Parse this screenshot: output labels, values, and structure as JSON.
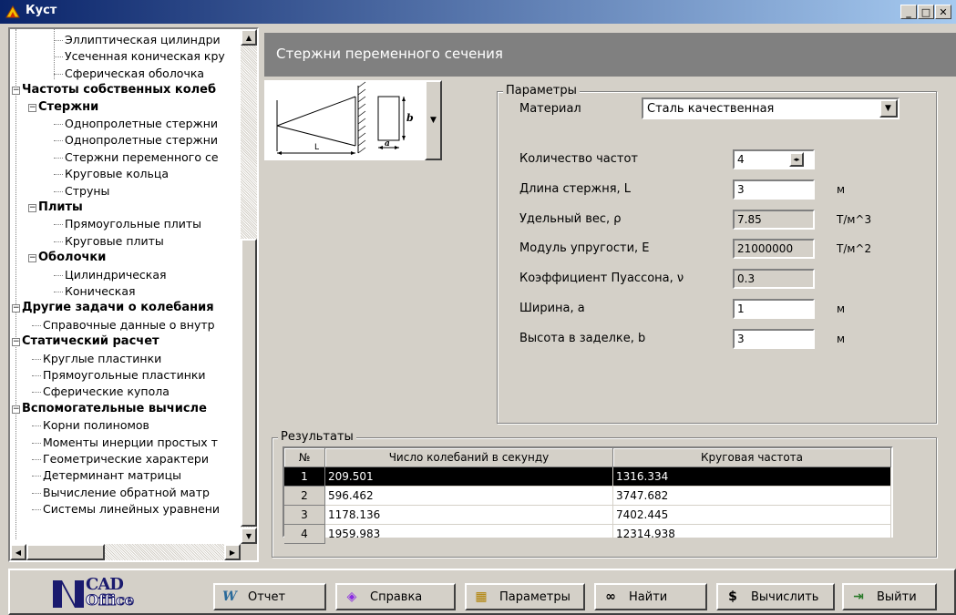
{
  "window": {
    "title": "Куст"
  },
  "tree": {
    "items": [
      {
        "label": "Эллиптическая цилиндри",
        "level": 3,
        "bold": false
      },
      {
        "label": "Усеченная коническая кру",
        "level": 3,
        "bold": false
      },
      {
        "label": "Сферическая оболочка",
        "level": 3,
        "bold": false
      },
      {
        "label": "Частоты собственных колеб",
        "level": 1,
        "bold": true
      },
      {
        "label": "Стержни",
        "level": 2,
        "bold": true
      },
      {
        "label": "Однопролетные стержни",
        "level": 3,
        "bold": false
      },
      {
        "label": "Однопролетные стержни",
        "level": 3,
        "bold": false
      },
      {
        "label": "Стержни переменного се",
        "level": 3,
        "bold": false
      },
      {
        "label": "Круговые кольца",
        "level": 3,
        "bold": false
      },
      {
        "label": "Струны",
        "level": 3,
        "bold": false
      },
      {
        "label": "Плиты",
        "level": 2,
        "bold": true
      },
      {
        "label": "Прямоугольные плиты",
        "level": 3,
        "bold": false
      },
      {
        "label": "Круговые плиты",
        "level": 3,
        "bold": false
      },
      {
        "label": "Оболочки",
        "level": 2,
        "bold": true
      },
      {
        "label": "Цилиндрическая",
        "level": 3,
        "bold": false
      },
      {
        "label": "Коническая",
        "level": 3,
        "bold": false
      },
      {
        "label": "Другие задачи о колебания",
        "level": 1,
        "bold": true
      },
      {
        "label": "Справочные данные о внутр",
        "level": 2,
        "bold": false
      },
      {
        "label": "Статический расчет",
        "level": 1,
        "bold": true
      },
      {
        "label": "Круглые пластинки",
        "level": 2,
        "bold": false
      },
      {
        "label": "Прямоугольные пластинки",
        "level": 2,
        "bold": false
      },
      {
        "label": "Сферические купола",
        "level": 2,
        "bold": false
      },
      {
        "label": "Вспомогательные вычисле",
        "level": 1,
        "bold": true
      },
      {
        "label": "Корни полиномов",
        "level": 2,
        "bold": false
      },
      {
        "label": "Моменты инерции простых т",
        "level": 2,
        "bold": false
      },
      {
        "label": "Геометрические характери",
        "level": 2,
        "bold": false
      },
      {
        "label": "Детерминант матрицы",
        "level": 2,
        "bold": false
      },
      {
        "label": "Вычисление обратной матр",
        "level": 2,
        "bold": false
      },
      {
        "label": "Системы линейных уравнени",
        "level": 2,
        "bold": false
      }
    ]
  },
  "panel": {
    "title": "Стержни переменного сечения",
    "diagram": {
      "length_label": "L",
      "width_label": "a",
      "height_label": "b"
    }
  },
  "params": {
    "group_title": "Параметры",
    "material_label": "Материал",
    "material_value": "Сталь качественная",
    "freq_count_label": "Количество частот",
    "freq_count_value": "4",
    "length_label": "Длина стержня, L",
    "length_value": "3",
    "length_unit": "м",
    "weight_label": "Удельный вес, ρ",
    "weight_value": "7.85",
    "weight_unit": "Т/м^3",
    "modulus_label": "Модуль упругости, E",
    "modulus_value": "21000000",
    "modulus_unit": "Т/м^2",
    "poisson_label": "Коэффициент Пуассона, ν",
    "poisson_value": "0.3",
    "width_label": "Ширина, a",
    "width_value": "1",
    "width_unit": "м",
    "height_label": "Высота в заделке, b",
    "height_value": "3",
    "height_unit": "м"
  },
  "results": {
    "group_title": "Результаты",
    "columns": [
      "№",
      "Число колебаний в секунду",
      "Круговая частота"
    ],
    "rows": [
      [
        "1",
        "209.501",
        "1316.334"
      ],
      [
        "2",
        "596.462",
        "3747.682"
      ],
      [
        "3",
        "1178.136",
        "7402.445"
      ],
      [
        "4",
        "1959.983",
        "12314.938"
      ]
    ]
  },
  "toolbar": {
    "logo_top": "CAD",
    "logo_bottom": "Office",
    "report": "Отчет",
    "help": "Справка",
    "params": "Параметры",
    "find": "Найти",
    "calc": "Вычислить",
    "exit": "Выйти"
  },
  "icons": {
    "app": "tree-app-icon",
    "report": "word-icon",
    "help": "book-icon",
    "params": "settings-icon",
    "find": "binoculars-icon",
    "calc": "dollar-icon",
    "exit": "exit-door-icon"
  }
}
